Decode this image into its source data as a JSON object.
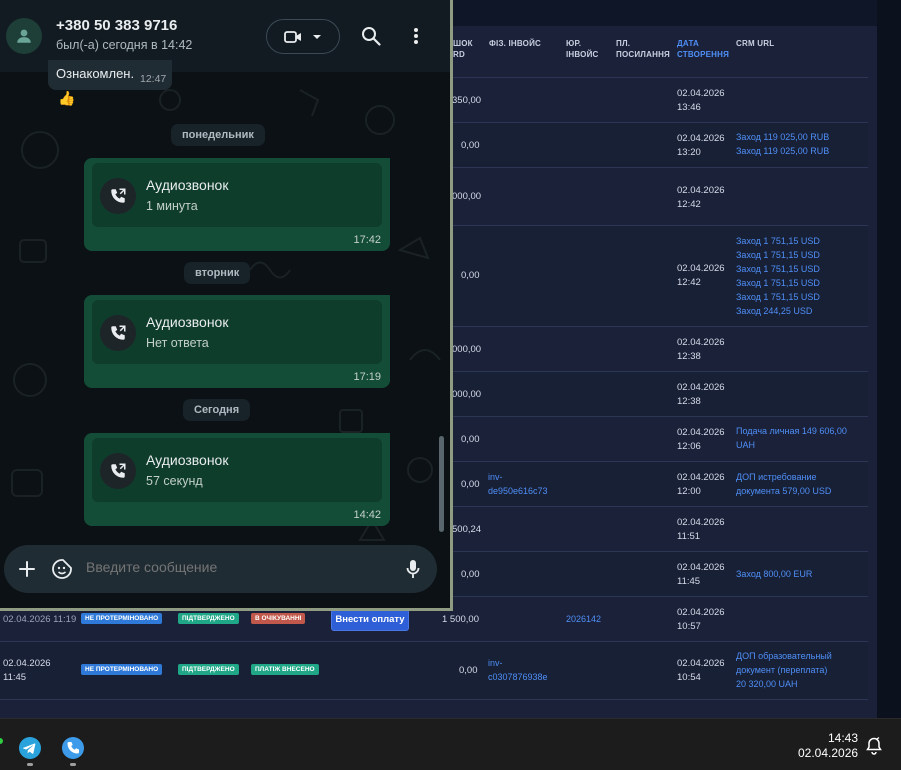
{
  "crm": {
    "headers": [
      "шок\nrd",
      "фіз. інвойс",
      "юр.\nінвойс",
      "пл.\nпосилання",
      "дата\nстворення",
      "crm url"
    ],
    "rows": [
      {
        "amount": "350,00",
        "date": "02.04.2026",
        "time": "13:46",
        "crm": []
      },
      {
        "amount": "0,00",
        "date": "02.04.2026",
        "time": "13:20",
        "crm": [
          "Заход 119 025,00 RUB",
          "Заход 119 025,00 RUB"
        ]
      },
      {
        "amount": "000,00",
        "date": "02.04.2026",
        "time": "12:42",
        "crm": []
      },
      {
        "amount": "0,00",
        "date": "02.04.2026",
        "time": "12:42",
        "crm": [
          "Заход 1 751,15 USD",
          "Заход 1 751,15 USD",
          "Заход 1 751,15 USD",
          "Заход 1 751,15 USD",
          "Заход 1 751,15 USD",
          "Заход 244,25 USD"
        ]
      },
      {
        "amount": "000,00",
        "date": "02.04.2026",
        "time": "12:38",
        "crm": []
      },
      {
        "amount": "000,00",
        "date": "02.04.2026",
        "time": "12:38",
        "crm": []
      },
      {
        "amount": "0,00",
        "date": "02.04.2026",
        "time": "12:06",
        "crm": [
          "Подача личная 149 606,00",
          "UAH"
        ]
      },
      {
        "amount": "0,00",
        "phys_invoice": "inv-\nde950e616c73",
        "date": "02.04.2026",
        "time": "12:00",
        "crm": [
          "ДОП истребование",
          "документа 579,00 USD"
        ]
      },
      {
        "amount": "500,24",
        "date": "02.04.2026",
        "time": "11:51",
        "crm": []
      },
      {
        "amount": "0,00",
        "date": "02.04.2026",
        "time": "11:45",
        "crm": [
          "Заход 800,00 EUR"
        ]
      },
      {
        "left_date": "02.04.2026 11:19",
        "badges": [
          "НЕ ПРОТЕРМІНОВАНО",
          "ПІДТВЕРДЖЕНО",
          "В ОЧІКУВАННІ"
        ],
        "button": "Внести оплату",
        "amount": "1 500,00",
        "jur_invoice": "2026142",
        "date": "02.04.2026",
        "time": "10:57",
        "crm": []
      },
      {
        "left_date": "02.04.2026",
        "left_time": "11:45",
        "badges": [
          "НЕ ПРОТЕРМІНОВАНО",
          "ПІДТВЕРДЖЕНО",
          "ПЛАТІЖ ВНЕСЕНО"
        ],
        "amount": "0,00",
        "phys_invoice": "inv-\nc0307876938e",
        "date": "02.04.2026",
        "time": "10:54",
        "crm": [
          "ДОП образовательный",
          "документ (переплата)",
          "20 320,00 UAH"
        ]
      }
    ]
  },
  "whatsapp": {
    "contact_name": "+380 50 383 9716",
    "contact_status": "был(-а) сегодня в 14:42",
    "incoming_text": "Ознакомлен.",
    "incoming_time": "12:47",
    "reaction": "👍",
    "days": [
      {
        "label": "понедельник",
        "call_title": "Аудиозвонок",
        "call_sub": "1 минута",
        "time": "17:42"
      },
      {
        "label": "вторник",
        "call_title": "Аудиозвонок",
        "call_sub": "Нет ответа",
        "time": "17:19"
      },
      {
        "label": "Сегодня",
        "call_title": "Аудиозвонок",
        "call_sub": "57 секунд",
        "time": "14:42"
      }
    ],
    "composer_placeholder": "Введите сообщение"
  },
  "taskbar": {
    "time": "14:43",
    "date": "02.04.2026"
  },
  "colors": {
    "wa_bubble": "#144d37",
    "crm_link": "#4f8ff7",
    "badge_blue": "#2f7ad9",
    "badge_green": "#1fa787",
    "badge_red": "#c0584b"
  }
}
